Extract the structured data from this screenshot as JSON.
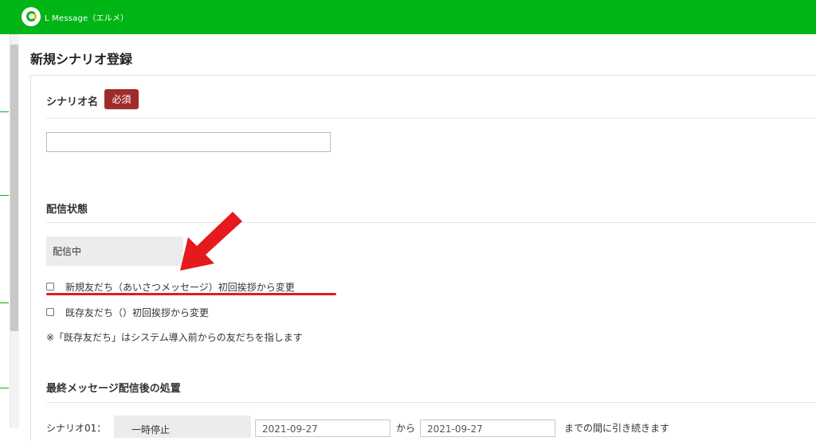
{
  "header": {
    "app_title": "L Message（エルメ）"
  },
  "page": {
    "title": "新規シナリオ登録"
  },
  "form": {
    "scenario_name": {
      "label": "シナリオ名",
      "required_badge": "必須",
      "value": "",
      "placeholder": ""
    },
    "delivery_status": {
      "label": "配信状態",
      "current_value": "配信中",
      "options": [
        {
          "label": "新規友だち（あいさつメッセージ）初回挨拶から変更",
          "checked": false
        },
        {
          "label": "既存友だち（）初回挨拶から変更",
          "checked": false
        }
      ],
      "note": "※「既存友だち」はシステム導入前からの友だちを指します"
    },
    "after_last_message": {
      "label": "最終メッセージ配信後の処置",
      "prefix_label": "シナリオ01：",
      "action_value": "一時停止",
      "date_from": "2021-09-27",
      "from_text": "から",
      "date_to": "2021-09-27",
      "suffix_text": "までの間に引き続きます"
    }
  },
  "annotations": {
    "highlight_color": "#e6191c",
    "arrow_icon": "red-arrow-icon"
  },
  "colors": {
    "brand_green": "#00b516",
    "required_red": "#a02b2b"
  }
}
